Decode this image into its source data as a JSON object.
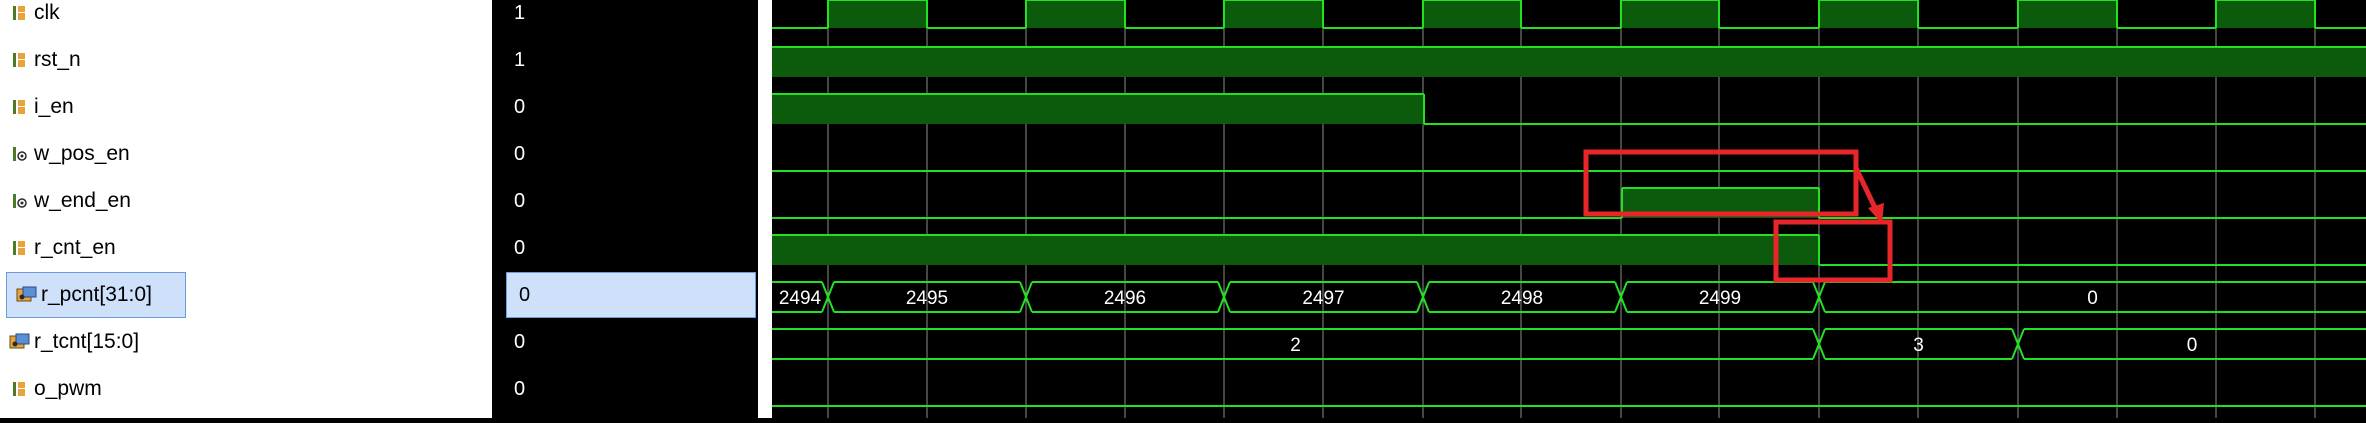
{
  "signals": [
    {
      "name": "clk",
      "value": "1",
      "icon": "bit-signal-icon"
    },
    {
      "name": "rst_n",
      "value": "1",
      "icon": "bit-signal-icon"
    },
    {
      "name": "i_en",
      "value": "0",
      "icon": "bit-signal-icon"
    },
    {
      "name": "w_pos_en",
      "value": "0",
      "icon": "wire-signal-icon"
    },
    {
      "name": "w_end_en",
      "value": "0",
      "icon": "wire-signal-icon"
    },
    {
      "name": "r_cnt_en",
      "value": "0",
      "icon": "bit-signal-icon"
    },
    {
      "name": "r_pcnt[31:0]",
      "value": "0",
      "icon": "bus-signal-icon"
    },
    {
      "name": "r_tcnt[15:0]",
      "value": "0",
      "icon": "bus-signal-icon"
    },
    {
      "name": "o_pwm",
      "value": "0",
      "icon": "bit-signal-icon"
    }
  ],
  "selected_signal": "r_pcnt[31:0]",
  "waves": {
    "r_pcnt_labels": [
      "2494",
      "2495",
      "2496",
      "2497",
      "2498",
      "2499",
      "0"
    ],
    "r_tcnt_labels": [
      "2",
      "3",
      "0"
    ]
  },
  "colors": {
    "wave_line": "#22e022",
    "wave_fill": "#0c5a0c",
    "grid": "#bdbdbd",
    "annotation": "#e8262a",
    "selection": "#cfe0fa"
  }
}
